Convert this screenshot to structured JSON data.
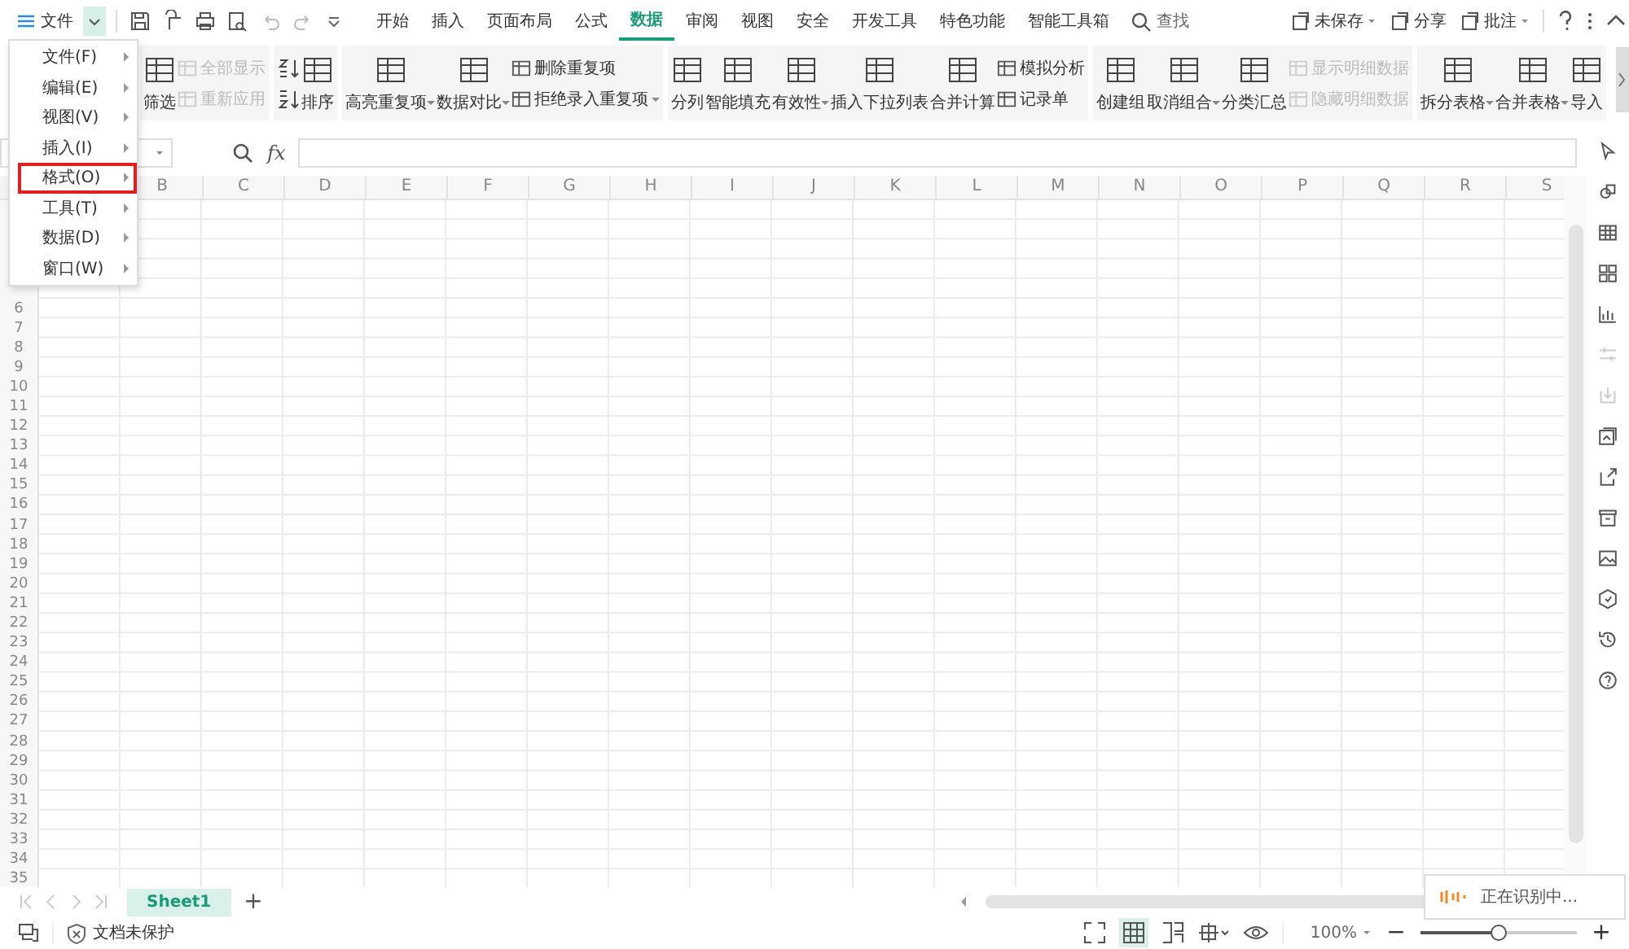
{
  "menu_button": {
    "label": "文件"
  },
  "tabs": [
    {
      "label": "开始",
      "selected": false
    },
    {
      "label": "插入",
      "selected": false
    },
    {
      "label": "页面布局",
      "selected": false
    },
    {
      "label": "公式",
      "selected": false
    },
    {
      "label": "数据",
      "selected": true
    },
    {
      "label": "审阅",
      "selected": false
    },
    {
      "label": "视图",
      "selected": false
    },
    {
      "label": "安全",
      "selected": false
    },
    {
      "label": "开发工具",
      "selected": false
    },
    {
      "label": "特色功能",
      "selected": false
    },
    {
      "label": "智能工具箱",
      "selected": false
    }
  ],
  "search": {
    "label": "查找"
  },
  "top_actions": [
    {
      "label": "未保存",
      "dropdown": true
    },
    {
      "label": "分享",
      "dropdown": false
    },
    {
      "label": "批注",
      "dropdown": true
    }
  ],
  "ribbon": {
    "groups": [
      {
        "items": [
          {
            "kind": "large",
            "label": "筛选",
            "dropdown": false,
            "disabled": false
          },
          {
            "kind": "stack",
            "entries": [
              {
                "label": "全部显示",
                "dropdown": false,
                "disabled": true
              },
              {
                "label": "重新应用",
                "dropdown": false,
                "disabled": true
              }
            ]
          }
        ]
      },
      {
        "items": [
          {
            "kind": "iconstack"
          },
          {
            "kind": "large",
            "label": "排序",
            "dropdown": false,
            "disabled": false
          }
        ]
      },
      {
        "items": [
          {
            "kind": "large",
            "label": "高亮重复项",
            "dropdown": true,
            "disabled": false
          },
          {
            "kind": "large",
            "label": "数据对比",
            "dropdown": true,
            "disabled": false
          },
          {
            "kind": "stack",
            "entries": [
              {
                "label": "删除重复项",
                "dropdown": false,
                "disabled": false
              },
              {
                "label": "拒绝录入重复项",
                "dropdown": true,
                "disabled": false
              }
            ]
          }
        ]
      },
      {
        "items": [
          {
            "kind": "large",
            "label": "分列",
            "dropdown": false,
            "disabled": false
          },
          {
            "kind": "large",
            "label": "智能填充",
            "dropdown": false,
            "disabled": false
          },
          {
            "kind": "large",
            "label": "有效性",
            "dropdown": true,
            "disabled": false
          },
          {
            "kind": "large",
            "label": "插入下拉列表",
            "dropdown": false,
            "disabled": false
          },
          {
            "kind": "large",
            "label": "合并计算",
            "dropdown": false,
            "disabled": false
          },
          {
            "kind": "stack",
            "entries": [
              {
                "label": "模拟分析",
                "dropdown": false,
                "disabled": false
              },
              {
                "label": "记录单",
                "dropdown": false,
                "disabled": false
              }
            ]
          }
        ]
      },
      {
        "items": [
          {
            "kind": "large",
            "label": "创建组",
            "dropdown": false,
            "disabled": false
          },
          {
            "kind": "large",
            "label": "取消组合",
            "dropdown": true,
            "disabled": false
          },
          {
            "kind": "large",
            "label": "分类汇总",
            "dropdown": false,
            "disabled": false
          },
          {
            "kind": "stack",
            "entries": [
              {
                "label": "显示明细数据",
                "dropdown": false,
                "disabled": true
              },
              {
                "label": "隐藏明细数据",
                "dropdown": false,
                "disabled": true
              }
            ]
          }
        ]
      },
      {
        "items": [
          {
            "kind": "large",
            "label": "拆分表格",
            "dropdown": true,
            "disabled": false
          },
          {
            "kind": "large",
            "label": "合并表格",
            "dropdown": true,
            "disabled": false
          },
          {
            "kind": "large",
            "label": "导入",
            "dropdown": false,
            "disabled": false
          }
        ]
      }
    ]
  },
  "formula_bar": {
    "fx": "fx"
  },
  "columns": [
    "B",
    "C",
    "D",
    "E",
    "F",
    "G",
    "H",
    "I",
    "J",
    "K",
    "L",
    "M",
    "N",
    "O",
    "P",
    "Q",
    "R",
    "S"
  ],
  "rows": [
    "6",
    "7",
    "8",
    "9",
    "10",
    "11",
    "12",
    "13",
    "14",
    "15",
    "16",
    "17",
    "18",
    "19",
    "20",
    "21",
    "22",
    "23",
    "24",
    "25",
    "26",
    "27",
    "28",
    "29",
    "30",
    "31",
    "32",
    "33",
    "34",
    "35"
  ],
  "context_menu": {
    "items": [
      {
        "label": "文件(F)",
        "highlighted": false
      },
      {
        "label": "编辑(E)",
        "highlighted": false
      },
      {
        "label": "视图(V)",
        "highlighted": false
      },
      {
        "label": "插入(I)",
        "highlighted": false
      },
      {
        "label": "格式(O)",
        "highlighted": true
      },
      {
        "label": "工具(T)",
        "highlighted": false
      },
      {
        "label": "数据(D)",
        "highlighted": false
      },
      {
        "label": "窗口(W)",
        "highlighted": false
      }
    ]
  },
  "sheet_tabs": [
    {
      "label": "Sheet1",
      "selected": true
    }
  ],
  "add_sheet": "+",
  "status_bar": {
    "protection": "文档未保护",
    "zoom": "100%",
    "minus": "−",
    "plus": "+",
    "zoom_slider": {
      "level": 0.5
    }
  },
  "toast": {
    "text": "正在识别中..."
  }
}
